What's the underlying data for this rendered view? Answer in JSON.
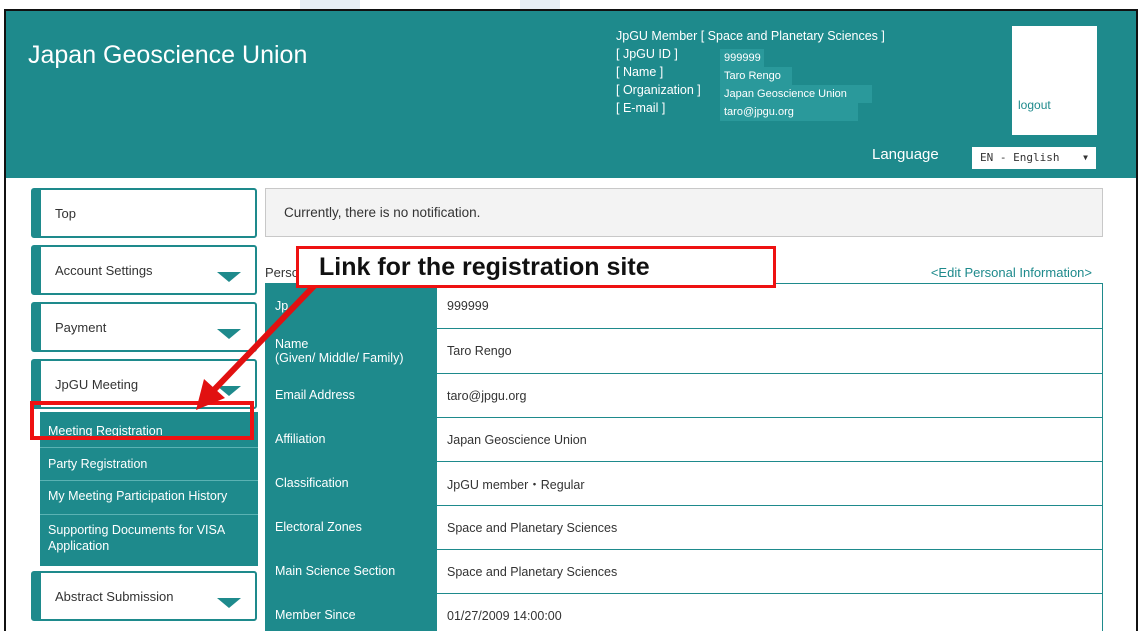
{
  "header": {
    "site_title": "Japan Geoscience Union",
    "member_line": "JpGU Member [ Space and Planetary Sciences ]",
    "info": [
      {
        "label": "[ JpGU ID ]",
        "value": "999999"
      },
      {
        "label": "[ Name ]",
        "value": "Taro Rengo"
      },
      {
        "label": "[ Organization ]",
        "value": "Japan Geoscience Union"
      },
      {
        "label": "[ E-mail ]",
        "value": "taro@jpgu.org"
      }
    ],
    "logout": "logout",
    "language_label": "Language",
    "language_value": "EN - English"
  },
  "sidebar": {
    "items": [
      {
        "label": "Top"
      },
      {
        "label": "Account Settings"
      },
      {
        "label": "Payment"
      },
      {
        "label": "JpGU Meeting"
      },
      {
        "label": "Abstract Submission"
      }
    ],
    "submenu": [
      {
        "label": "Meeting Registration"
      },
      {
        "label": "Party Registration"
      },
      {
        "label": "My Meeting Participation History"
      },
      {
        "label": "Supporting Documents for VISA",
        "label2": "Application"
      }
    ]
  },
  "main": {
    "notification": "Currently, there is no notification.",
    "personal_title": "Perso",
    "edit_link": "<Edit Personal Information>",
    "rows": [
      {
        "label": "Jp",
        "label2": "",
        "value": "999999"
      },
      {
        "label": "Name",
        "label2": "(Given/ Middle/ Family)",
        "value": "Taro Rengo"
      },
      {
        "label": "Email Address",
        "label2": "",
        "value": "taro@jpgu.org"
      },
      {
        "label": "Affiliation",
        "label2": "",
        "value": "Japan Geoscience Union"
      },
      {
        "label": "Classification",
        "label2": "",
        "value": "JpGU member・Regular"
      },
      {
        "label": "Electoral Zones",
        "label2": "",
        "value": "Space and Planetary Sciences"
      },
      {
        "label": "Main Science Section",
        "label2": "",
        "value": "Space and Planetary Sciences"
      },
      {
        "label": "Member Since",
        "label2": "",
        "value": "01/27/2009 14:00:00"
      }
    ]
  },
  "annotation": {
    "callout_text": "Link for the registration site"
  },
  "colors": {
    "teal": "#1e8a8c",
    "annotation_red": "#e11111"
  }
}
